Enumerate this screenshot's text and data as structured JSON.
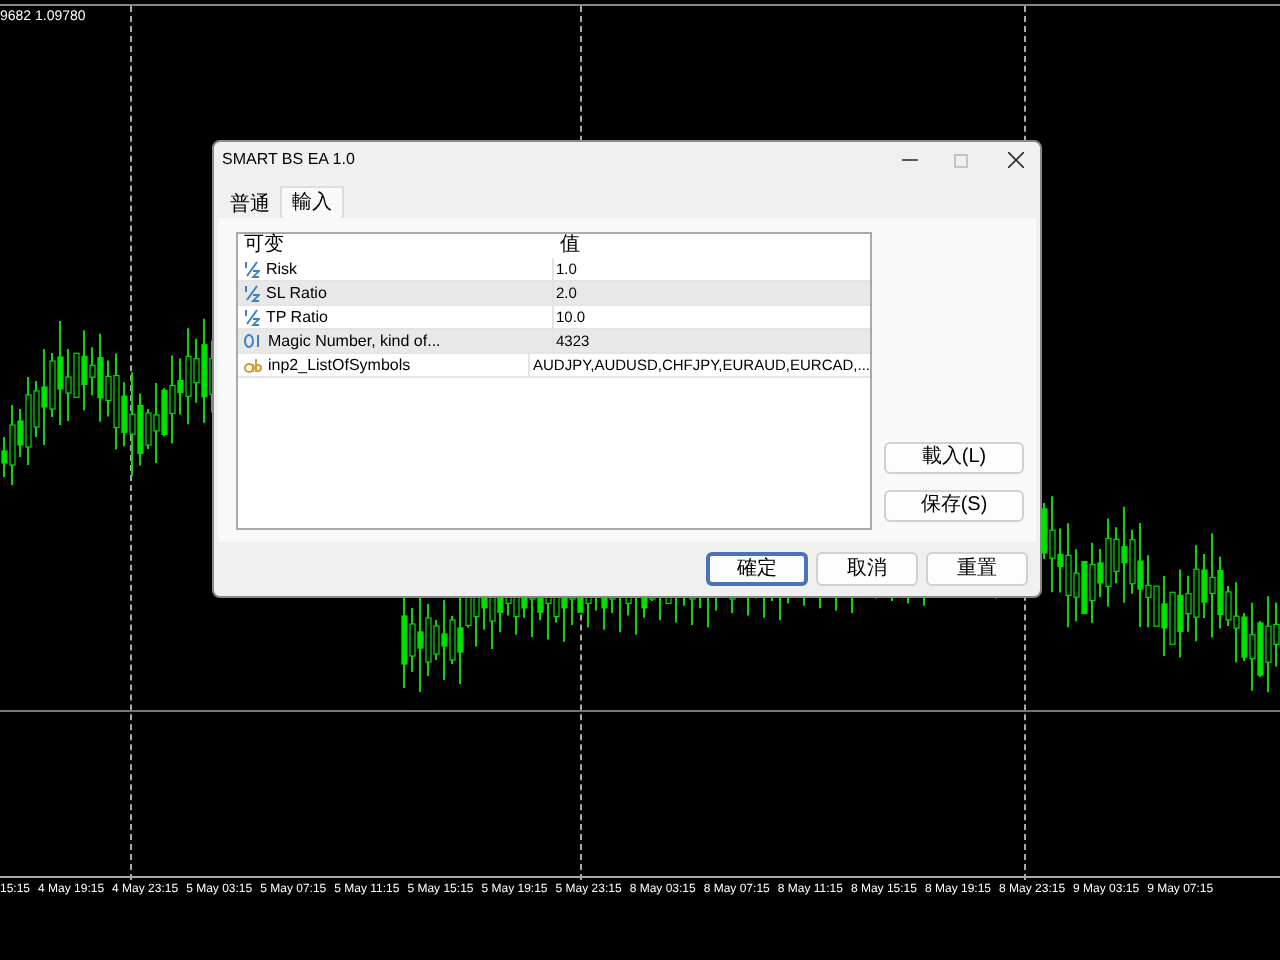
{
  "chart": {
    "price_label": "9682 1.09780",
    "time_labels": [
      "15:15",
      "4 May 19:15",
      "4 May 23:15",
      "5 May 03:15",
      "5 May 07:15",
      "5 May 11:15",
      "5 May 15:15",
      "5 May 19:15",
      "5 May 23:15",
      "8 May 03:15",
      "8 May 07:15",
      "8 May 11:15",
      "8 May 15:15",
      "8 May 19:15",
      "8 May 23:15",
      "9 May 03:15",
      "9 May 07:15"
    ]
  },
  "window": {
    "title": "SMART BS EA 1.0"
  },
  "tabs": [
    {
      "label": "普通",
      "selected": false
    },
    {
      "label": "輸入",
      "selected": true
    }
  ],
  "table": {
    "columns": [
      "可变",
      "值"
    ],
    "rows": [
      {
        "kind": "double",
        "name": "Risk",
        "value": "1.0",
        "selected": false
      },
      {
        "kind": "double",
        "name": "SL Ratio",
        "value": "2.0",
        "selected": true
      },
      {
        "kind": "double",
        "name": "TP Ratio",
        "value": "10.0",
        "selected": false
      },
      {
        "kind": "int",
        "name": "Magic Number, kind of...",
        "value": "4323",
        "selected": true
      },
      {
        "kind": "string",
        "name": "inp2_ListOfSymbols",
        "value": "AUDJPY,AUDUSD,CHFJPY,EURAUD,EURCAD,...",
        "selected": false
      }
    ]
  },
  "side_buttons": [
    "載入(L)",
    "保存(S)"
  ],
  "buttons": [
    {
      "label": "確定",
      "default": true
    },
    {
      "label": "取消",
      "default": false
    },
    {
      "label": "重置",
      "default": false
    }
  ]
}
